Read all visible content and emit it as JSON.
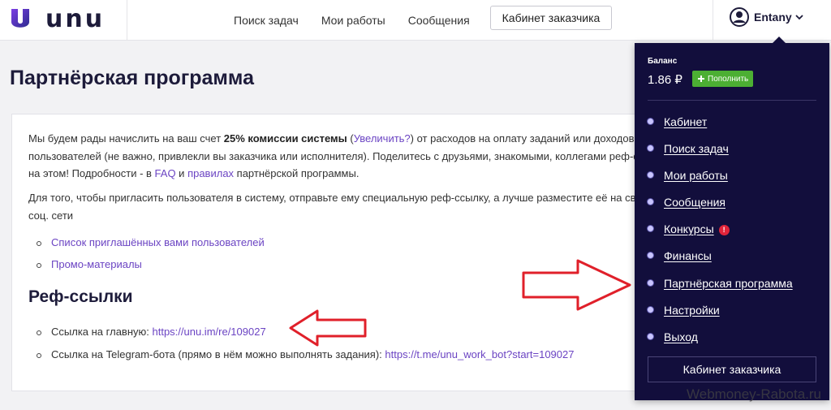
{
  "header": {
    "logo_text": "unu",
    "nav": [
      "Поиск задач",
      "Мои работы",
      "Сообщения"
    ],
    "customer_button": "Кабинет заказчика",
    "username": "Entany"
  },
  "page": {
    "title": "Партнёрская программа"
  },
  "card": {
    "p1_line1_a": "Мы будем рады начислить на ваш счет ",
    "p1_line1_bold": "25% комиссии системы",
    "p1_line1_b": " (",
    "p1_line1_link": "Увеличить?",
    "p1_line1_c": ") от расходов на оплату заданий или доходов от выполнения заданий приглашённых вами",
    "p1_line2": "пользователей (не важно, привлекли вы заказчика или исполнителя). Поделитесь с друзьями, знакомыми, коллегами реф-ссылкой и начните зарабатывать",
    "p1_line3_a": "на этом! Подробности - в ",
    "p1_line3_faq": "FAQ",
    "p1_line3_b": " и ",
    "p1_line3_rules": "правилах",
    "p1_line3_c": " партнёрской программы.",
    "p2_line1": "Для того, чтобы пригласить пользователя в систему, отправьте ему специальную реф-ссылку, а лучше разместите её на своём сайте, блоге, странице в",
    "p2_line2": "соц. сети",
    "links": [
      "Список приглашённых вами пользователей",
      "Промо-материалы"
    ],
    "ref_title": "Реф-ссылки",
    "ref_main_label": "Ссылка на главную: ",
    "ref_main_url": "https://unu.im/re/109027",
    "ref_bot_label": "Ссылка на Telegram-бота (прямо в нём можно выполнять задания): ",
    "ref_bot_url": "https://t.me/unu_work_bot?start=109027"
  },
  "dropdown": {
    "balance_label": "Баланс",
    "balance_value": "1.86 ₽",
    "topup_label": "Пополнить",
    "menu": [
      "Кабинет",
      "Поиск задач",
      "Мои работы",
      "Сообщения",
      "Конкурсы",
      "Финансы",
      "Партнёрская программа",
      "Настройки",
      "Выход"
    ],
    "contest_badge": "!",
    "customer_button": "Кабинет заказчика"
  },
  "watermark": "Webmoney-Rabota.ru",
  "colors": {
    "brand_dark": "#1d1b3a",
    "link": "#6b44c3",
    "dropdown_bg": "#120e3c",
    "topup_green": "#4caf33",
    "arrow_red": "#e0202a"
  }
}
